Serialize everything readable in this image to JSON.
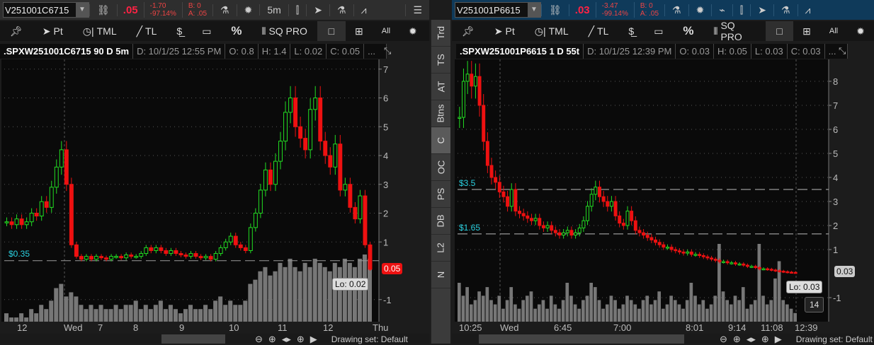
{
  "left": {
    "symbol": "V251001C6715",
    "last": ".05",
    "change": "-1.70",
    "change_pct": "-97.14%",
    "bid": "B: 0",
    "ask": "A: .05",
    "timeframe": "5m",
    "header": {
      "title": ".SPXW251001C6715 90 D 5m",
      "date": "D: 10/1/25 12:55 PM",
      "open": "O: 0.8",
      "high": "H: 1.4",
      "low": "L: 0.02",
      "close": "C: 0.05",
      "more": "..."
    },
    "y_ticks": [
      "7",
      "6",
      "5",
      "4",
      "3",
      "2",
      "1",
      "-1"
    ],
    "x_ticks": [
      "12",
      "Wed",
      "7",
      "8",
      "9",
      "10",
      "11",
      "12",
      "Thu"
    ],
    "level_label": "$0.35",
    "level": 0.35,
    "price_tag": "0.05",
    "lo_bubble": "Lo: 0.02",
    "closes": [
      1.7,
      1.6,
      1.8,
      1.6,
      1.7,
      2.0,
      1.9,
      2.4,
      2.2,
      2.9,
      3.6,
      4.2,
      3.0,
      0.9,
      0.5,
      0.4,
      0.5,
      0.4,
      0.5,
      0.45,
      0.4,
      0.5,
      0.5,
      0.45,
      0.55,
      0.5,
      0.5,
      0.6,
      0.8,
      0.7,
      0.8,
      0.7,
      0.6,
      0.7,
      0.6,
      0.55,
      0.5,
      0.6,
      0.5,
      0.45,
      0.5,
      0.4,
      0.6,
      0.8,
      1.0,
      1.2,
      0.9,
      0.8,
      0.7,
      1.5,
      2.0,
      2.8,
      3.5,
      3.0,
      3.8,
      4.5,
      5.5,
      6.0,
      5.0,
      4.6,
      4.2,
      5.6,
      6.0,
      4.5,
      4.0,
      3.6,
      4.4,
      2.8,
      3.0,
      2.2,
      1.8,
      2.6,
      0.9,
      0.05
    ],
    "volumes": [
      2,
      1,
      1,
      2,
      1,
      3,
      2,
      4,
      3,
      5,
      8,
      9,
      6,
      7,
      6,
      4,
      3,
      4,
      3,
      4,
      3,
      3,
      4,
      3,
      4,
      4,
      5,
      3,
      4,
      3,
      4,
      5,
      3,
      4,
      3,
      2,
      3,
      4,
      3,
      3,
      4,
      3,
      5,
      6,
      4,
      5,
      4,
      4,
      5,
      9,
      10,
      12,
      13,
      11,
      12,
      14,
      13,
      15,
      13,
      12,
      14,
      13,
      15,
      14,
      13,
      12,
      14,
      13,
      15,
      14,
      13,
      15,
      16,
      15
    ],
    "grid_dates": [
      "Wed",
      "12"
    ]
  },
  "right": {
    "symbol": "V251001P6615",
    "last": ".03",
    "change": "-3.47",
    "change_pct": "-99.14%",
    "bid": "B: 0",
    "ask": "A: .05",
    "header": {
      "title": ".SPXW251001P6615 1 D 55t",
      "date": "D: 10/1/25 12:39 PM",
      "open": "O: 0.03",
      "high": "H: 0.05",
      "low": "L: 0.03",
      "close": "C: 0.03",
      "more": "..."
    },
    "y_ticks": [
      "8",
      "7",
      "6",
      "5",
      "4",
      "3",
      "2",
      "1",
      "-1"
    ],
    "x_ticks": [
      "10:25",
      "Wed",
      "6:45",
      "7:00",
      "8:01",
      "9:14",
      "11:08",
      "12:39"
    ],
    "levels": [
      {
        "label": "$3.5",
        "value": 3.5
      },
      {
        "label": "$1.65",
        "value": 1.65
      }
    ],
    "price_tag": "0.03",
    "lo_bubble": "Lo: 0.03",
    "bar_count": "14",
    "closes": [
      6.5,
      8.0,
      8.3,
      7.8,
      8.2,
      7.0,
      5.5,
      4.5,
      4.0,
      3.8,
      3.4,
      3.2,
      2.8,
      3.5,
      2.6,
      2.5,
      2.4,
      2.3,
      2.2,
      2.3,
      2.0,
      1.9,
      2.0,
      1.8,
      1.7,
      1.6,
      1.7,
      1.8,
      1.6,
      1.7,
      1.9,
      2.2,
      2.8,
      3.3,
      3.6,
      3.2,
      3.0,
      2.8,
      3.0,
      2.4,
      2.1,
      2.0,
      2.6,
      2.2,
      1.8,
      1.7,
      1.6,
      1.5,
      1.4,
      1.3,
      1.2,
      1.1,
      1.1,
      1.0,
      0.95,
      0.9,
      0.85,
      0.9,
      0.8,
      0.8,
      0.75,
      0.7,
      0.65,
      0.6,
      0.55,
      0.5,
      0.5,
      0.45,
      0.45,
      0.4,
      0.4,
      0.35,
      0.3,
      0.3,
      0.25,
      0.2,
      0.2,
      0.18,
      0.15,
      0.12,
      0.1,
      0.08,
      0.06,
      0.05,
      0.03
    ],
    "volumes": [
      9,
      6,
      8,
      4,
      5,
      7,
      6,
      8,
      5,
      4,
      6,
      3,
      5,
      8,
      4,
      3,
      5,
      6,
      7,
      3,
      4,
      5,
      3,
      6,
      4,
      3,
      5,
      9,
      6,
      4,
      3,
      5,
      6,
      9,
      8,
      5,
      3,
      4,
      6,
      5,
      3,
      4,
      6,
      5,
      4,
      3,
      5,
      6,
      4,
      5,
      7,
      3,
      4,
      6,
      5,
      4,
      3,
      5,
      9,
      6,
      4,
      5,
      3,
      4,
      6,
      18,
      7,
      5,
      4,
      6,
      5,
      8,
      3,
      4,
      5,
      18,
      6,
      4,
      5,
      10,
      14,
      5,
      4,
      3,
      2
    ]
  },
  "tabs": [
    "Trd",
    "TS",
    "AT",
    "Btns",
    "C",
    "OC",
    "PS",
    "DB",
    "L2",
    "N"
  ],
  "active_tab": "C",
  "tools": {
    "pin": "pin-icon",
    "pt": "Pt",
    "tml": "TML",
    "tl": "TL",
    "pct": "%",
    "sqpro": "SQ PRO",
    "all": "All"
  },
  "drawing_set": "Drawing set: Default",
  "colors": {
    "up": "#22dd22",
    "down": "#ee1111",
    "level": "#2ad0e0",
    "volume": "#777777"
  }
}
